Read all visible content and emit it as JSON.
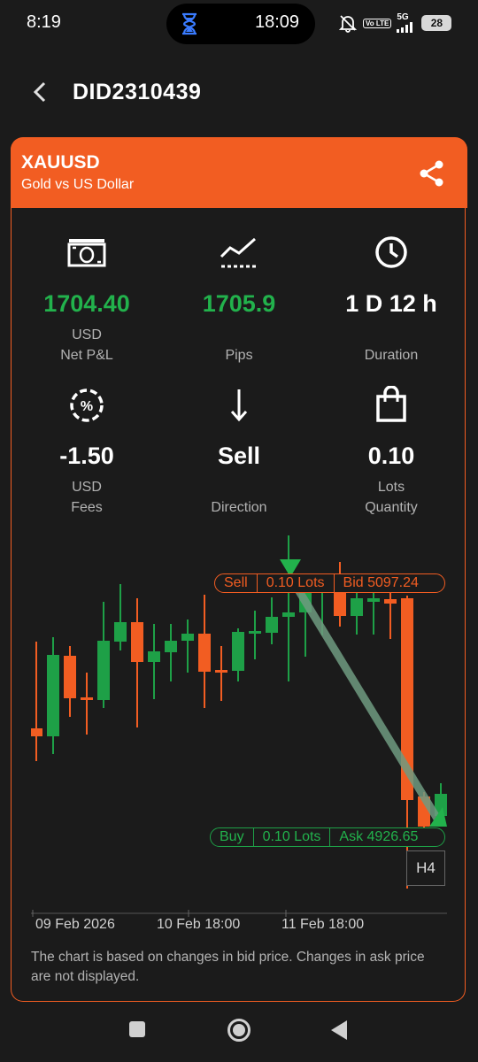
{
  "status_bar": {
    "time": "8:19",
    "pill_time": "18:09",
    "network_lte": "Vo LTE",
    "network_5g": "5G",
    "battery": "28",
    "icons": [
      "hourglass-icon",
      "mute-bell-icon",
      "signal-icon",
      "battery-icon"
    ]
  },
  "header": {
    "title": "DID2310439",
    "back_icon": "chevron-left-icon"
  },
  "instrument": {
    "symbol": "XAUUSD",
    "description": "Gold vs US Dollar",
    "share_icon": "share-icon",
    "accent_color": "#f25d22"
  },
  "stats": [
    {
      "icon": "banknote-icon",
      "value": "1704.40",
      "unit": "USD",
      "label": "Net P&L"
    },
    {
      "icon": "trend-line-icon",
      "value": "1705.9",
      "unit": "",
      "label": "Pips"
    },
    {
      "icon": "clock-icon",
      "value": "1 D 12 h",
      "unit": "",
      "label": "Duration"
    },
    {
      "icon": "percent-circle-icon",
      "value": "-1.50",
      "unit": "USD",
      "label": "Fees"
    },
    {
      "icon": "arrow-down-icon",
      "value": "Sell",
      "unit": "",
      "label": "Direction"
    },
    {
      "icon": "shopping-bag-icon",
      "value": "0.10",
      "unit": "Lots",
      "label": "Quantity"
    }
  ],
  "chart": {
    "entry_tag": {
      "side": "Sell",
      "lots": "0.10 Lots",
      "price": "Bid 5097.24"
    },
    "exit_tag": {
      "side": "Buy",
      "lots": "0.10 Lots",
      "price": "Ask 4926.65"
    },
    "timeframe": "H4",
    "x_labels": [
      "09 Feb 2026",
      "10 Feb 18:00",
      "11 Feb 18:00"
    ],
    "note": "The chart is based on changes in bid price. Changes in ask price are not displayed.",
    "up_color": "#1ea047",
    "down_color": "#f25d22"
  },
  "nav_bar": {
    "icons": [
      "recents-square-icon",
      "home-circle-icon",
      "back-triangle-icon"
    ]
  }
}
